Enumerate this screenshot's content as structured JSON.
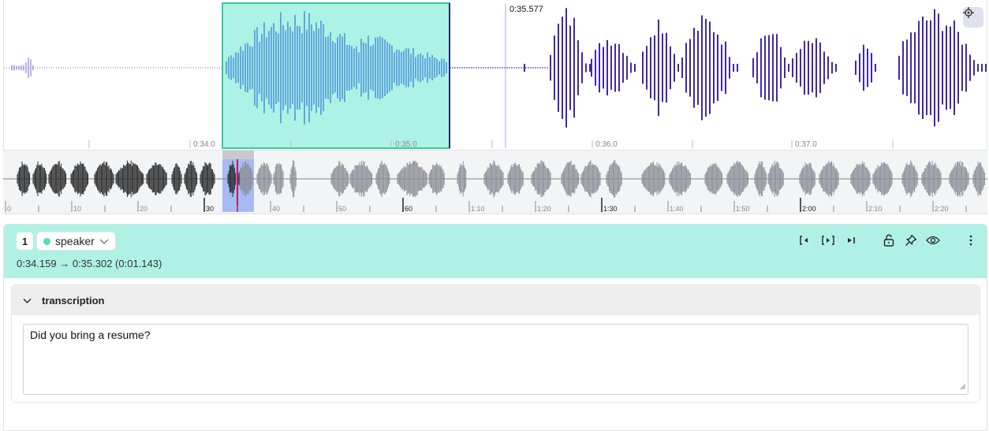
{
  "detail": {
    "cursor_time": "0:35.577",
    "tick_labels": [
      "0:34.0",
      "0:35.0",
      "0:36.0",
      "0:37.0"
    ],
    "colors": {
      "selection_fill": "#aef2e5",
      "selection_border": "#35c9a6",
      "wave_selected": "#4a90d9",
      "wave_default": "#4028a8"
    }
  },
  "overview": {
    "tick_labels": [
      "0",
      "10",
      "20",
      "30",
      "40",
      "50",
      "60",
      "1:10",
      "1:20",
      "1:30",
      "1:40",
      "1:50",
      "2:00",
      "2:10",
      "2:20"
    ],
    "colors": {
      "played": "#2a2a2a",
      "unplayed": "#8d8f99",
      "viewport": "#a2b6f2",
      "playhead": "#c2185b"
    }
  },
  "segment": {
    "index": "1",
    "speaker": "speaker",
    "time_range": "0:34.159 → 0:35.302 (0:01.143)",
    "transcription_title": "transcription",
    "transcription_text": "Did you bring a resume?",
    "icons": [
      "skip-to-start-icon",
      "play-segment-icon",
      "skip-to-end-icon",
      "unlock-icon",
      "pin-icon",
      "eye-icon",
      "more-vertical-icon"
    ]
  }
}
